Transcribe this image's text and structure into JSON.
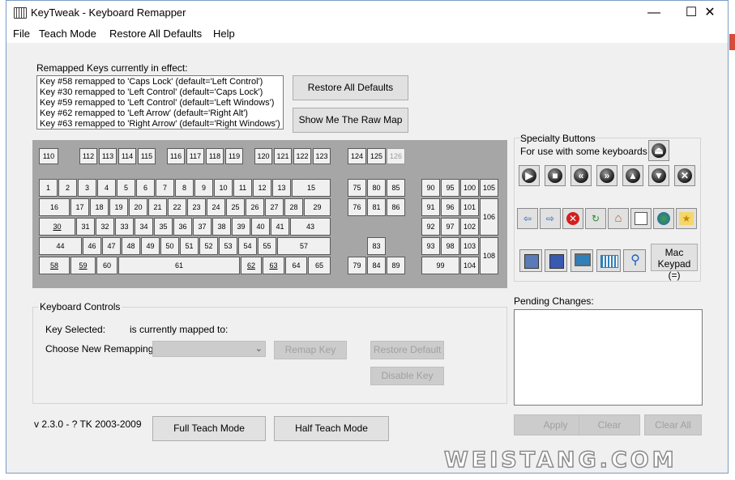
{
  "window": {
    "title": "KeyTweak -  Keyboard Remapper",
    "minimize": "—",
    "maximize": "☐",
    "close": "✕"
  },
  "menu": [
    "File",
    "Teach Mode",
    "Restore All Defaults",
    "Help"
  ],
  "remapped": {
    "label": "Remapped Keys currently in effect:",
    "items": [
      "Key #58 remapped to 'Caps Lock' (default='Left Control')",
      "Key #30 remapped to 'Left Control' (default='Caps Lock')",
      "Key #59 remapped to 'Left Control' (default='Left Windows')",
      "Key #62 remapped to 'Left Arrow' (default='Right Alt')",
      "Key #63 remapped to 'Right Arrow' (default='Right Windows')"
    ]
  },
  "buttons": {
    "restore_all": "Restore All Defaults",
    "raw_map": "Show Me The Raw Map",
    "full_teach": "Full Teach Mode",
    "half_teach": "Half Teach Mode"
  },
  "keyboard": {
    "keys": [
      {
        "n": "110"
      },
      {
        "n": "112"
      },
      {
        "n": "113"
      },
      {
        "n": "114"
      },
      {
        "n": "115"
      },
      {
        "n": "116"
      },
      {
        "n": "117"
      },
      {
        "n": "118"
      },
      {
        "n": "119"
      },
      {
        "n": "120"
      },
      {
        "n": "121"
      },
      {
        "n": "122"
      },
      {
        "n": "123"
      },
      {
        "n": "124"
      },
      {
        "n": "125"
      },
      {
        "n": "126",
        "disabled": true
      },
      {
        "n": "1"
      },
      {
        "n": "2"
      },
      {
        "n": "3"
      },
      {
        "n": "4"
      },
      {
        "n": "5"
      },
      {
        "n": "6"
      },
      {
        "n": "7"
      },
      {
        "n": "8"
      },
      {
        "n": "9"
      },
      {
        "n": "10"
      },
      {
        "n": "11"
      },
      {
        "n": "12"
      },
      {
        "n": "13"
      },
      {
        "n": "15"
      },
      {
        "n": "16"
      },
      {
        "n": "17"
      },
      {
        "n": "18"
      },
      {
        "n": "19"
      },
      {
        "n": "20"
      },
      {
        "n": "21"
      },
      {
        "n": "22"
      },
      {
        "n": "23"
      },
      {
        "n": "24"
      },
      {
        "n": "25"
      },
      {
        "n": "26"
      },
      {
        "n": "27"
      },
      {
        "n": "28"
      },
      {
        "n": "29"
      },
      {
        "n": "30",
        "remapped": true
      },
      {
        "n": "31"
      },
      {
        "n": "32"
      },
      {
        "n": "33"
      },
      {
        "n": "34"
      },
      {
        "n": "35"
      },
      {
        "n": "36"
      },
      {
        "n": "37"
      },
      {
        "n": "38"
      },
      {
        "n": "39"
      },
      {
        "n": "40"
      },
      {
        "n": "41"
      },
      {
        "n": "43"
      },
      {
        "n": "44"
      },
      {
        "n": "46"
      },
      {
        "n": "47"
      },
      {
        "n": "48"
      },
      {
        "n": "49"
      },
      {
        "n": "50"
      },
      {
        "n": "51"
      },
      {
        "n": "52"
      },
      {
        "n": "53"
      },
      {
        "n": "54"
      },
      {
        "n": "55"
      },
      {
        "n": "57"
      },
      {
        "n": "58",
        "remapped": true
      },
      {
        "n": "59",
        "remapped": true
      },
      {
        "n": "60"
      },
      {
        "n": "61"
      },
      {
        "n": "62",
        "remapped": true
      },
      {
        "n": "63",
        "remapped": true
      },
      {
        "n": "64"
      },
      {
        "n": "65"
      },
      {
        "n": "75"
      },
      {
        "n": "80"
      },
      {
        "n": "85"
      },
      {
        "n": "76"
      },
      {
        "n": "81"
      },
      {
        "n": "86"
      },
      {
        "n": "83"
      },
      {
        "n": "79"
      },
      {
        "n": "84"
      },
      {
        "n": "89"
      },
      {
        "n": "90"
      },
      {
        "n": "95"
      },
      {
        "n": "100"
      },
      {
        "n": "105"
      },
      {
        "n": "91"
      },
      {
        "n": "96"
      },
      {
        "n": "101"
      },
      {
        "n": "106"
      },
      {
        "n": "92"
      },
      {
        "n": "97"
      },
      {
        "n": "102"
      },
      {
        "n": "93"
      },
      {
        "n": "98"
      },
      {
        "n": "103"
      },
      {
        "n": "108"
      },
      {
        "n": "99"
      },
      {
        "n": "104"
      }
    ]
  },
  "specialty": {
    "title": "Specialty Buttons",
    "subtitle": "For use with some keyboards",
    "icons": [
      "eject-icon",
      "play-icon",
      "stop-icon",
      "rewind-icon",
      "fast-forward-icon",
      "volume-up-icon",
      "volume-down-icon",
      "mute-icon",
      "back-arrow-icon",
      "forward-arrow-icon",
      "stop-red-icon",
      "refresh-icon",
      "home-icon",
      "search-doc-icon",
      "internet-icon",
      "favorites-icon",
      "computer-icon",
      "computer-alt-icon",
      "monitor-icon",
      "calculator-icon",
      "magnifier-icon"
    ],
    "glyphs": {
      "back": "⇦",
      "forward": "⇨",
      "stop": "✕",
      "refresh": "↻",
      "home": "⌂",
      "fav": "★",
      "search": "⚲"
    },
    "mac_keypad": "Mac Keypad (=)"
  },
  "controls": {
    "title": "Keyboard Controls",
    "key_selected": "Key Selected:",
    "mapped_to": "is currently mapped to:",
    "choose": "Choose New Remapping",
    "remap": "Remap Key",
    "restore_default": "Restore Default",
    "disable": "Disable Key"
  },
  "pending": {
    "label": "Pending Changes:",
    "apply": "Apply",
    "clear": "Clear",
    "clear_all": "Clear All"
  },
  "version": "v 2.3.0 - ? TK 2003-2009",
  "watermark": "WEISTANG.COM"
}
